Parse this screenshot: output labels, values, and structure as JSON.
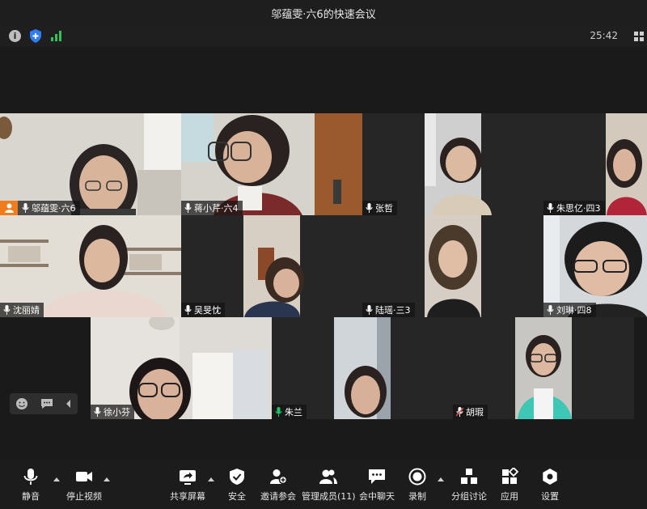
{
  "window": {
    "title": "邬蕴雯·六6的快速会议"
  },
  "infobar": {
    "timer": "25:42"
  },
  "participants": [
    {
      "name": "邬蕴雯·六6",
      "mic": "on",
      "host": true
    },
    {
      "name": "蒋小芹·六4",
      "mic": "on"
    },
    {
      "name": "张哲",
      "mic": "on"
    },
    {
      "name": "朱思亿·四3",
      "mic": "on"
    },
    {
      "name": "沈丽婧",
      "mic": "on"
    },
    {
      "name": "吴旻忱",
      "mic": "on"
    },
    {
      "name": "陆瑶·三3",
      "mic": "on"
    },
    {
      "name": "刘琳·四8",
      "mic": "on"
    },
    {
      "name": "徐小芬",
      "mic": "on"
    },
    {
      "name": "朱兰",
      "mic": "active"
    },
    {
      "name": "胡瑕",
      "mic": "muted"
    }
  ],
  "toolbar": {
    "mute": "静音",
    "stop_video": "停止视频",
    "share_screen": "共享屏幕",
    "security": "安全",
    "invite": "邀请参会",
    "manage": "管理成员(11)",
    "chat": "会中聊天",
    "record": "录制",
    "breakout": "分组讨论",
    "apps": "应用",
    "settings": "设置"
  },
  "colors": {
    "active_speaker": "#1fc46a",
    "host_badge": "#f07c1d",
    "mic_active": "#1fc46a",
    "mic_muted": "#e04a4a"
  }
}
